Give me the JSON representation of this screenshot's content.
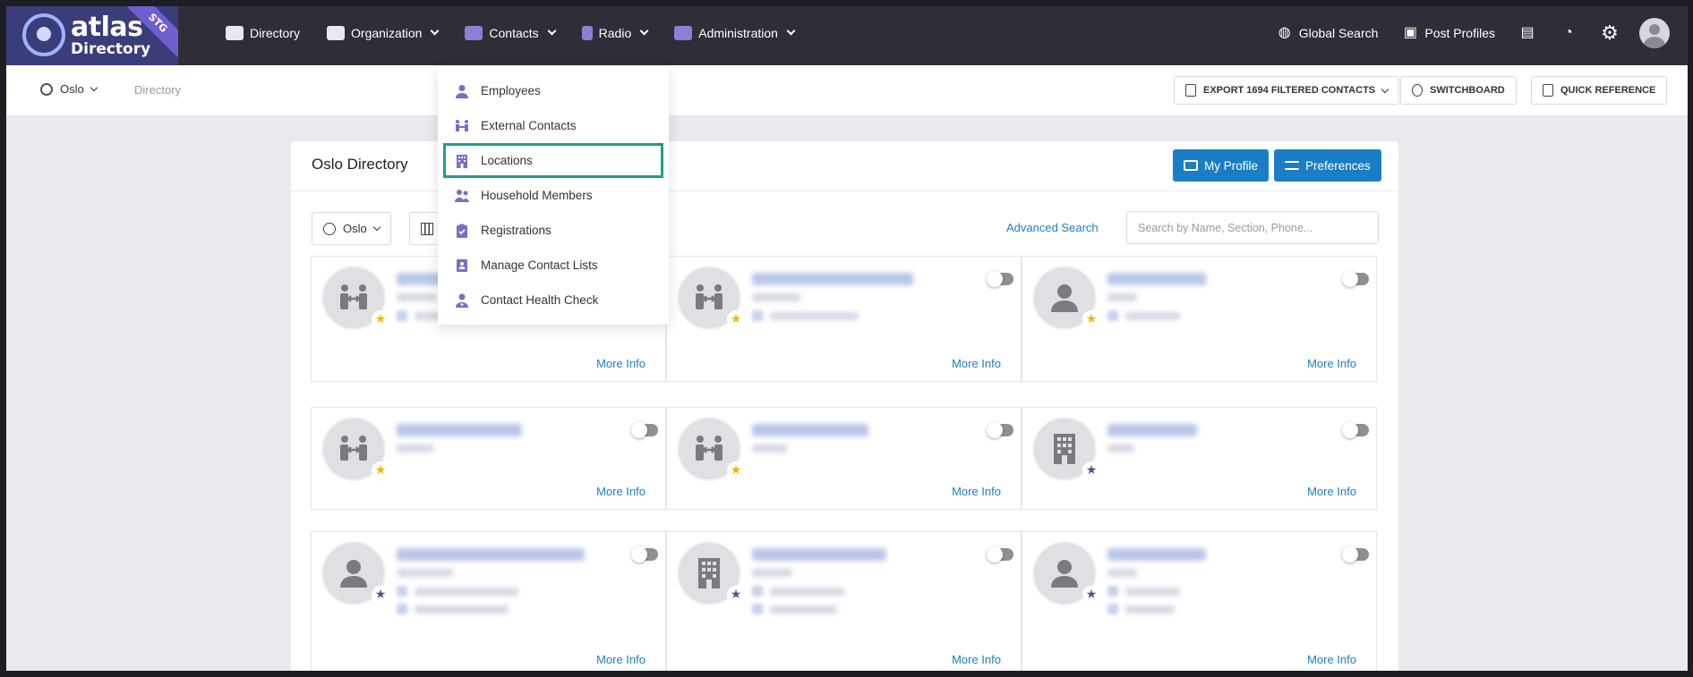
{
  "brand": {
    "name": "atlas",
    "subtitle": "Directory",
    "env_badge": "STG"
  },
  "nav": {
    "items": [
      {
        "label": "Directory",
        "icon": "directory-icon",
        "dropdown": false
      },
      {
        "label": "Organization",
        "icon": "organization-icon",
        "dropdown": true
      },
      {
        "label": "Contacts",
        "icon": "contacts-icon",
        "dropdown": true
      },
      {
        "label": "Radio",
        "icon": "radio-icon",
        "dropdown": true
      },
      {
        "label": "Administration",
        "icon": "tools-icon",
        "dropdown": true
      }
    ],
    "right": [
      {
        "label": "Global Search",
        "icon": "globe-search-icon"
      },
      {
        "label": "Post Profiles",
        "icon": "id-card-icon"
      }
    ]
  },
  "subbar": {
    "location": "Oslo",
    "breadcrumb": "Directory",
    "export_label": "EXPORT 1694 FILTERED CONTACTS",
    "switchboard_label": "SWITCHBOARD",
    "quick_ref_label": "QUICK REFERENCE"
  },
  "contacts_menu": {
    "items": [
      {
        "label": "Employees",
        "icon": "person-icon"
      },
      {
        "label": "External Contacts",
        "icon": "handshake-icon"
      },
      {
        "label": "Locations",
        "icon": "building-icon",
        "highlighted": true
      },
      {
        "label": "Household Members",
        "icon": "users-icon"
      },
      {
        "label": "Registrations",
        "icon": "clipboard-check-icon"
      },
      {
        "label": "Manage Contact Lists",
        "icon": "address-book-icon"
      },
      {
        "label": "Contact Health Check",
        "icon": "user-doctor-icon"
      }
    ]
  },
  "main": {
    "title": "Oslo Directory",
    "my_profile_label": "My Profile",
    "preferences_label": "Preferences",
    "location_filter": "Oslo",
    "advanced_search_label": "Advanced Search",
    "search_placeholder": "Search by Name, Section, Phone..."
  },
  "tiles": [
    {
      "avatar": "handshake",
      "star": "gold",
      "more": "More Info"
    },
    {
      "avatar": "handshake",
      "star": "gold",
      "more": "More Info"
    },
    {
      "avatar": "person",
      "star": "gold",
      "more": "More Info"
    },
    {
      "avatar": "handshake",
      "star": "gold",
      "more": "More Info"
    },
    {
      "avatar": "handshake",
      "star": "gold",
      "more": "More Info"
    },
    {
      "avatar": "building",
      "star": "navy",
      "more": "More Info"
    },
    {
      "avatar": "person",
      "star": "navy",
      "more": "More Info"
    },
    {
      "avatar": "building",
      "star": "navy",
      "more": "More Info"
    },
    {
      "avatar": "person",
      "star": "navy",
      "more": "More Info"
    }
  ],
  "colors": {
    "topbar": "#2f2e38",
    "accent_blue": "#1b7ec4",
    "menu_icon": "#7c6cc9",
    "highlight": "#1aa189"
  }
}
